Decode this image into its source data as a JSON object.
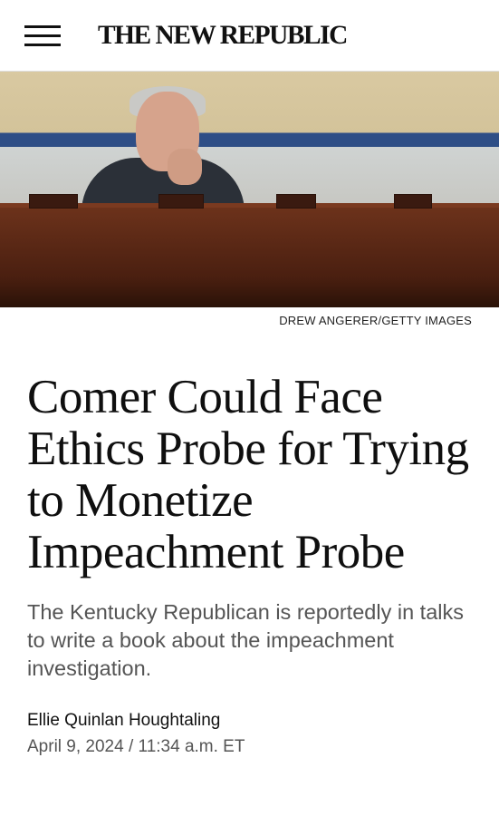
{
  "header": {
    "logo_text": "THE NEW REPUBLIC",
    "menu_icon": "hamburger-menu-icon"
  },
  "hero": {
    "image_credit": "DREW ANGERER/GETTY IMAGES"
  },
  "article": {
    "headline": "Comer Could Face Ethics Probe for Trying to Monetize Impeachment Probe",
    "dek": "The Kentucky Republican is reportedly in talks to write a book about the impeachment investigation.",
    "author": "Ellie Quinlan Houghtaling",
    "date": "April 9, 2024",
    "separator": "/",
    "time": "11:34 a.m. ET"
  },
  "colors": {
    "text": "#111111",
    "muted_text": "#555555",
    "background": "#ffffff"
  }
}
